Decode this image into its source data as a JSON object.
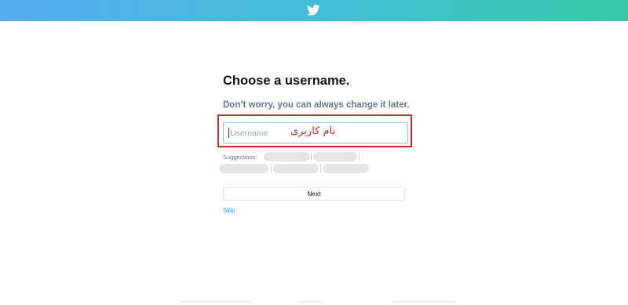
{
  "header": {
    "logo_icon": "twitter-bird-icon",
    "gradient_colors": [
      "#55acee",
      "#36c9a4"
    ]
  },
  "main": {
    "title": "Choose a username.",
    "subtitle": "Don’t worry, you can always change it later.",
    "username_field": {
      "placeholder": "Username",
      "value": ""
    },
    "annotation_text": "نام کاربری",
    "annotation_color": "#c62828",
    "suggestions_label": "Suggestions:",
    "next_label": "Next",
    "skip_label": "Skip"
  }
}
